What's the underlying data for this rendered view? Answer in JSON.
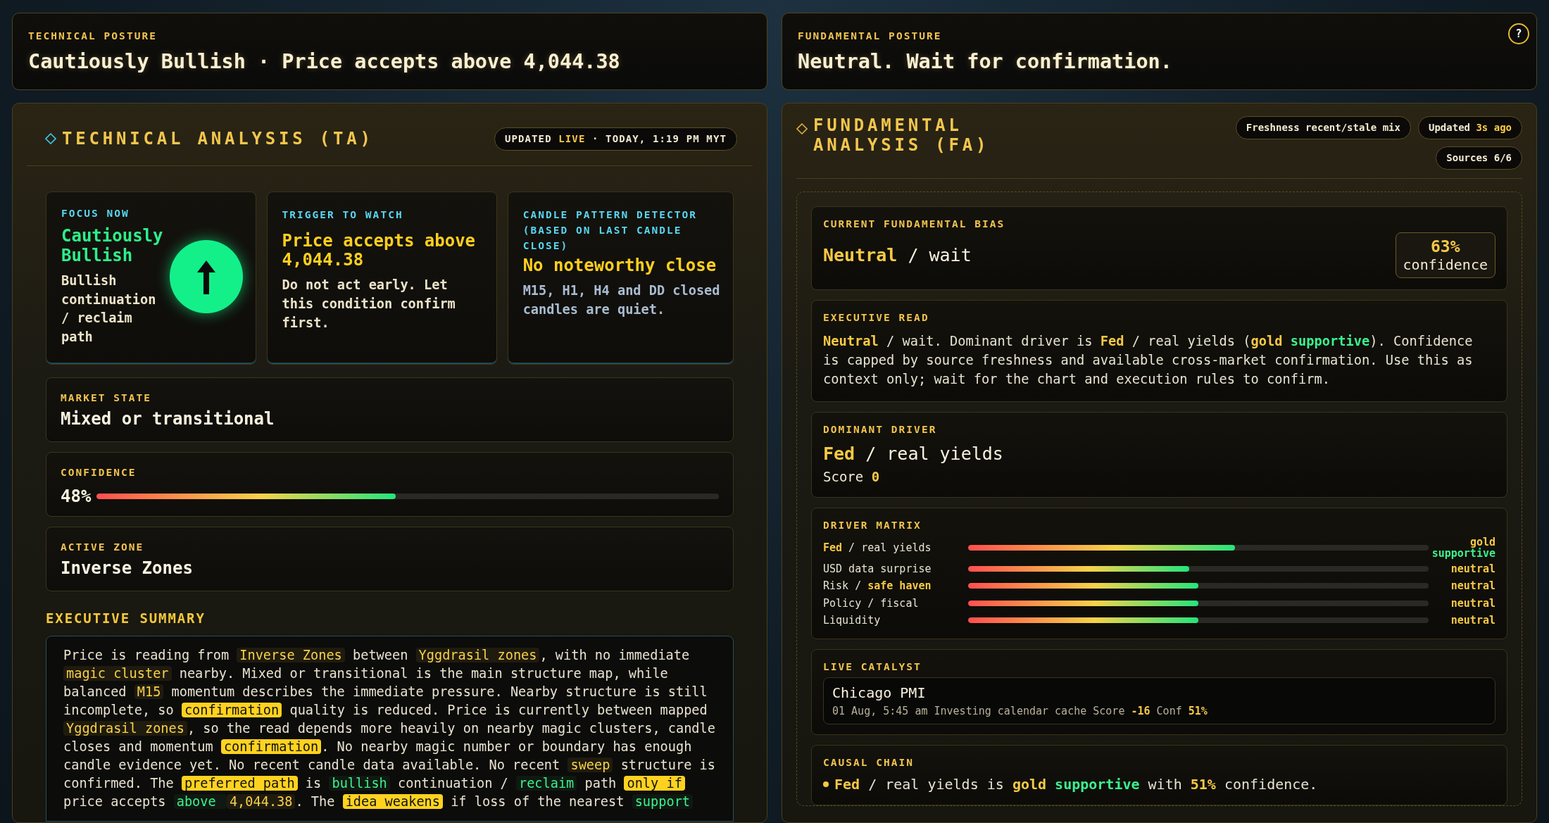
{
  "technical_posture": {
    "label": "TECHNICAL POSTURE",
    "headline": "Cautiously Bullish · Price accepts above 4,044.38"
  },
  "fundamental_posture": {
    "label": "FUNDAMENTAL POSTURE",
    "headline": "Neutral. Wait for confirmation."
  },
  "help_button": "?",
  "technical_analysis": {
    "title": "TECHNICAL ANALYSIS (TA)",
    "updated": [
      {
        "text": "UPDATED ",
        "kind": "plain"
      },
      {
        "text": "LIVE",
        "kind": "key"
      },
      {
        "text": " · TODAY, 1:19 PM MYT",
        "kind": "plain"
      }
    ],
    "cards": [
      {
        "kind": "focus",
        "label": "FOCUS NOW",
        "title": "Cautiously Bullish",
        "body": "Bullish continuation / reclaim path"
      },
      {
        "kind": "trigger",
        "label": "TRIGGER TO WATCH",
        "title": "Price accepts above 4,044.38",
        "body": "Do not act early. Let this condition confirm first."
      },
      {
        "kind": "pattern",
        "label": "CANDLE PATTERN DETECTOR (BASED ON LAST CANDLE CLOSE)",
        "title": "No noteworthy close",
        "body": "M15, H1, H4 and DD closed candles are quiet."
      }
    ],
    "market_state": {
      "label": "MARKET STATE",
      "value": "Mixed or transitional"
    },
    "confidence": {
      "label": "CONFIDENCE",
      "reading": "48%",
      "level": 0.48
    },
    "active_zone": {
      "label": "ACTIVE ZONE",
      "value": "Inverse Zones"
    },
    "summary_heading": "EXECUTIVE SUMMARY",
    "summary": [
      {
        "text": "Price is reading from ",
        "kind": "plain"
      },
      {
        "text": "Inverse Zones",
        "kind": "tag"
      },
      {
        "text": " between ",
        "kind": "plain"
      },
      {
        "text": "Yggdrasil zones",
        "kind": "tag"
      },
      {
        "text": ", with no immediate ",
        "kind": "plain"
      },
      {
        "text": "magic cluster",
        "kind": "tag"
      },
      {
        "text": " nearby. Mixed or transitional is the main structure map, while balanced ",
        "kind": "plain"
      },
      {
        "text": "M15",
        "kind": "tag"
      },
      {
        "text": " momentum describes the immediate pressure. Nearby structure is still incomplete, so ",
        "kind": "plain"
      },
      {
        "text": "confirmation",
        "kind": "mark"
      },
      {
        "text": " quality is reduced. Price is currently between mapped ",
        "kind": "plain"
      },
      {
        "text": "Yggdrasil zones",
        "kind": "tag"
      },
      {
        "text": ", so the read depends more heavily on nearby magic clusters, candle closes and momentum ",
        "kind": "plain"
      },
      {
        "text": "confirmation",
        "kind": "mark"
      },
      {
        "text": ". No nearby magic number or boundary has enough candle evidence yet. No recent candle data available. No recent ",
        "kind": "plain"
      },
      {
        "text": "sweep",
        "kind": "tag"
      },
      {
        "text": " structure is confirmed. The ",
        "kind": "plain"
      },
      {
        "text": "preferred path",
        "kind": "mark"
      },
      {
        "text": " is ",
        "kind": "plain"
      },
      {
        "text": "bullish",
        "kind": "good"
      },
      {
        "text": " continuation / ",
        "kind": "plain"
      },
      {
        "text": "reclaim",
        "kind": "good"
      },
      {
        "text": " path ",
        "kind": "plain"
      },
      {
        "text": "only if",
        "kind": "mark"
      },
      {
        "text": " price accepts ",
        "kind": "plain"
      },
      {
        "text": "above ",
        "kind": "good"
      },
      {
        "text": "4,044.38",
        "kind": "tag"
      },
      {
        "text": ". The ",
        "kind": "plain"
      },
      {
        "text": "idea weakens",
        "kind": "mark"
      },
      {
        "text": " if loss of the nearest ",
        "kind": "plain"
      },
      {
        "text": "support",
        "kind": "good"
      }
    ]
  },
  "fundamental_analysis": {
    "title": "FUNDAMENTAL ANALYSIS (FA)",
    "badges": [
      [
        {
          "text": "Freshness recent/stale mix",
          "kind": "plain"
        }
      ],
      [
        {
          "text": "Updated ",
          "kind": "plain"
        },
        {
          "text": "3s ago",
          "kind": "key"
        }
      ],
      [
        {
          "text": "Sources 6/6",
          "kind": "plain"
        }
      ]
    ],
    "bias": {
      "label": "CURRENT FUNDAMENTAL BIAS",
      "value": [
        {
          "text": "Neutral",
          "kind": "key"
        },
        {
          "text": " / wait",
          "kind": "plain"
        }
      ],
      "confidence_value": "63%",
      "confidence_label": "confidence"
    },
    "executive_read": {
      "label": "EXECUTIVE READ",
      "text": [
        {
          "text": "Neutral",
          "kind": "key"
        },
        {
          "text": " / wait. Dominant driver is ",
          "kind": "plain"
        },
        {
          "text": "Fed",
          "kind": "key"
        },
        {
          "text": " / real yields (",
          "kind": "plain"
        },
        {
          "text": "gold ",
          "kind": "key"
        },
        {
          "text": "supportive",
          "kind": "goodb"
        },
        {
          "text": "). Confidence is capped by source freshness and available cross-market confirmation. Use this as context only; wait for the chart and execution rules to confirm.",
          "kind": "plain"
        }
      ]
    },
    "dominant_driver": {
      "label": "DOMINANT DRIVER",
      "value": [
        {
          "text": "Fed",
          "kind": "key"
        },
        {
          "text": " / real yields",
          "kind": "plain"
        }
      ],
      "score": [
        {
          "text": "Score ",
          "kind": "plain"
        },
        {
          "text": "0",
          "kind": "key"
        }
      ]
    },
    "driver_matrix": {
      "label": "DRIVER MATRIX",
      "rows": [
        {
          "label": [
            {
              "text": "Fed",
              "kind": "key"
            },
            {
              "text": " / real yields",
              "kind": "plain"
            }
          ],
          "level": 0.58,
          "reading": [
            {
              "text": "gold",
              "kind": "key"
            },
            {
              "text": "supportive",
              "kind": "goodb"
            }
          ]
        },
        {
          "label": [
            {
              "text": "USD data surprise",
              "kind": "plain"
            }
          ],
          "level": 0.48,
          "reading": [
            {
              "text": "neutral",
              "kind": "key"
            }
          ]
        },
        {
          "label": [
            {
              "text": "Risk / ",
              "kind": "plain"
            },
            {
              "text": "safe haven",
              "kind": "key"
            }
          ],
          "level": 0.5,
          "reading": [
            {
              "text": "neutral",
              "kind": "key"
            }
          ]
        },
        {
          "label": [
            {
              "text": "Policy / fiscal",
              "kind": "plain"
            }
          ],
          "level": 0.5,
          "reading": [
            {
              "text": "neutral",
              "kind": "key"
            }
          ]
        },
        {
          "label": [
            {
              "text": "Liquidity",
              "kind": "plain"
            }
          ],
          "level": 0.5,
          "reading": [
            {
              "text": "neutral",
              "kind": "key"
            }
          ]
        }
      ]
    },
    "live_catalyst": {
      "label": "LIVE CATALYST",
      "event": "Chicago PMI",
      "meta": [
        {
          "text": "01 Aug, 5:45 am Investing calendar cache Score ",
          "kind": "plain"
        },
        {
          "text": "-16",
          "kind": "key"
        },
        {
          "text": " Conf ",
          "kind": "plain"
        },
        {
          "text": "51%",
          "kind": "key"
        }
      ]
    },
    "causal_chain": {
      "label": "CAUSAL CHAIN",
      "items": [
        [
          {
            "text": "Fed",
            "kind": "key"
          },
          {
            "text": " / real yields is ",
            "kind": "plain"
          },
          {
            "text": "gold ",
            "kind": "key"
          },
          {
            "text": "supportive",
            "kind": "goodb"
          },
          {
            "text": " with ",
            "kind": "plain"
          },
          {
            "text": "51%",
            "kind": "key"
          },
          {
            "text": " confidence.",
            "kind": "plain"
          }
        ]
      ]
    }
  }
}
